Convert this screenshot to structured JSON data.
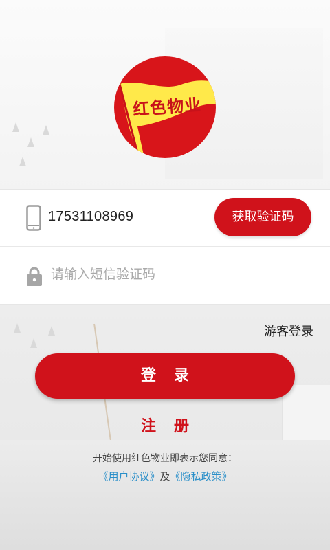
{
  "logo": {
    "text": "红色物业",
    "colors": {
      "circle": "#d8151a",
      "flag": "#ffe94a",
      "text": "#c8121a"
    }
  },
  "phone_row": {
    "icon": "phone-icon",
    "value": "17531108969",
    "get_code_label": "获取验证码"
  },
  "code_row": {
    "icon": "lock-icon",
    "placeholder": "请输入短信验证码",
    "value": ""
  },
  "guest_login_label": "游客登录",
  "login_label": "登录",
  "register_label": "注册",
  "agreement": {
    "intro": "开始使用红色物业即表示您同意：",
    "user_agreement": "《用户协议》",
    "conjunction": "及",
    "privacy_policy": "《隐私政策》"
  },
  "colors": {
    "accent": "#d0121b",
    "link": "#2a8fc9"
  }
}
